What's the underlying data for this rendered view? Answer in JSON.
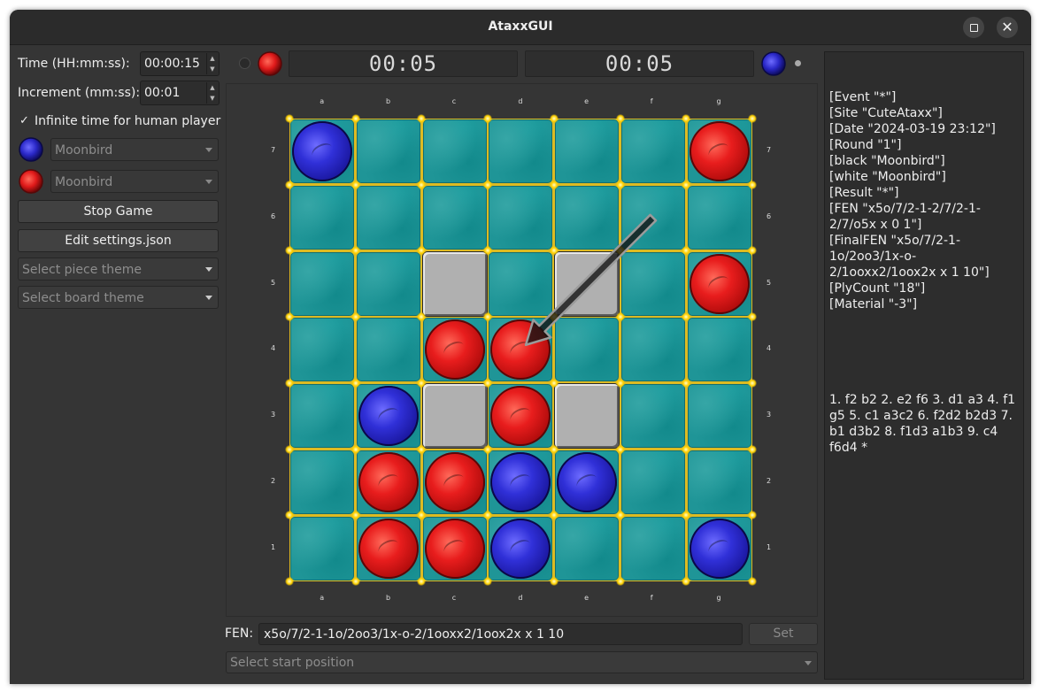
{
  "window": {
    "title": "AtaxxGUI"
  },
  "settings": {
    "time_label": "Time (HH:mm:ss):",
    "time_value": "00:00:15",
    "increment_label": "Increment (mm:ss):",
    "increment_value": "00:01",
    "infinite_check": "✓",
    "infinite_label": "Infinite time for human player",
    "blue_player": "Moonbird",
    "red_player": "Moonbird",
    "stop_button": "Stop Game",
    "edit_button": "Edit settings.json",
    "piece_theme_placeholder": "Select piece theme",
    "board_theme_placeholder": "Select board theme"
  },
  "clocks": {
    "left": "00:05",
    "right": "00:05"
  },
  "board": {
    "files": [
      "a",
      "b",
      "c",
      "d",
      "e",
      "f",
      "g"
    ],
    "ranks": [
      "7",
      "6",
      "5",
      "4",
      "3",
      "2",
      "1"
    ],
    "rows": [
      "x.....o",
      ".......",
      "..#.#.o",
      "..oo...",
      ".x#o#..",
      ".ooxx..",
      ".oox..x"
    ],
    "arrow": {
      "from": "f6",
      "to": "d4"
    }
  },
  "pgn": {
    "headers": [
      "[Event \"*\"]",
      "[Site \"CuteAtaxx\"]",
      "[Date \"2024-03-19 23:12\"]",
      "[Round \"1\"]",
      "[black \"Moonbird\"]",
      "[white \"Moonbird\"]",
      "[Result \"*\"]",
      "[FEN \"x5o/7/2-1-2/7/2-1-2/7/o5x x 0 1\"]",
      "[FinalFEN \"x5o/7/2-1-1o/2oo3/1x-o-2/1ooxx2/1oox2x x 1 10\"]",
      "[PlyCount \"18\"]",
      "[Material \"-3\"]"
    ],
    "moves": "1. f2 b2 2. e2 f6 3. d1 a3 4. f1 g5 5. c1 a3c2 6. f2d2 b2d3 7. b1 d3b2 8. f1d3 a1b3 9. c4 f6d4 *"
  },
  "fen": {
    "label": "FEN:",
    "value": "x5o/7/2-1-1o/2oo3/1x-o-2/1ooxx2/1oox2x x 1 10",
    "set_button": "Set",
    "start_position_placeholder": "Select start position"
  }
}
